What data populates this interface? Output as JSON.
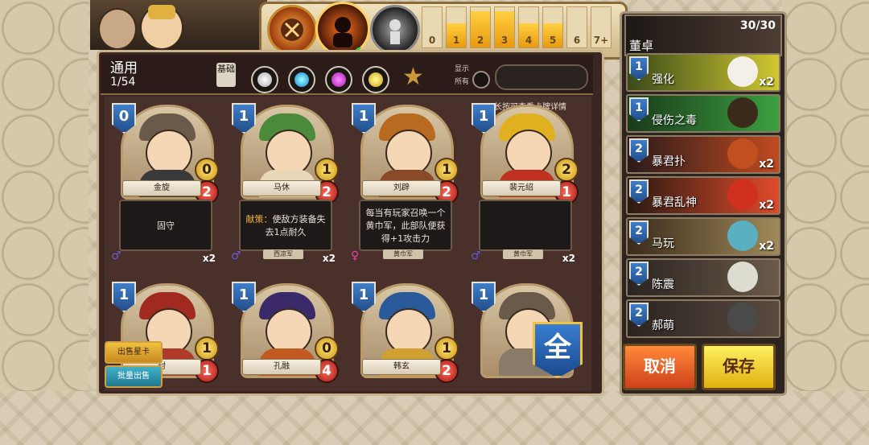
{
  "collection": {
    "title": "通用",
    "count": "1/54",
    "basic_label": "基础",
    "show_all_label_1": "显示",
    "show_all_label_2": "所有",
    "long_press_hint": "长按可查看卡牌详情"
  },
  "mana_filter": {
    "labels": [
      "0",
      "1",
      "2",
      "3",
      "4",
      "5",
      "6",
      "7+"
    ],
    "fill_ratio": [
      0.0,
      0.6,
      0.9,
      0.9,
      0.6,
      0.6,
      0.0,
      0.0
    ]
  },
  "cards_row1": [
    {
      "cost": "0",
      "name": "金旋",
      "attack": "0",
      "health": "2",
      "text": "固守",
      "keyword": "",
      "faction": "",
      "count": "x2",
      "gender": "♂",
      "gender_color": "#6b5ad0"
    },
    {
      "cost": "1",
      "name": "马休",
      "attack": "1",
      "health": "2",
      "text": "使敌方装备失去1点耐久",
      "keyword": "献策：",
      "faction": "西凉军",
      "count": "x2",
      "gender": "♂",
      "gender_color": "#6b5ad0"
    },
    {
      "cost": "1",
      "name": "刘辟",
      "attack": "1",
      "health": "2",
      "text": "每当有玩家召唤一个黄巾军，此部队便获得+1攻击力",
      "keyword": "",
      "faction": "黄巾军",
      "count": "",
      "gender": "♀",
      "gender_color": "#e04a9a"
    },
    {
      "cost": "1",
      "name": "裴元绍",
      "attack": "2",
      "health": "1",
      "text": "",
      "keyword": "",
      "faction": "黄巾军",
      "count": "x2",
      "gender": "♂",
      "gender_color": "#6b5ad0"
    }
  ],
  "cards_row2": [
    {
      "cost": "1",
      "name": "封",
      "attack": "1",
      "health": "1"
    },
    {
      "cost": "1",
      "name": "孔融",
      "attack": "0",
      "health": "4"
    },
    {
      "cost": "1",
      "name": "韩玄",
      "attack": "1",
      "health": "2"
    },
    {
      "cost": "1",
      "name": "",
      "attack": "",
      "health": ""
    }
  ],
  "all_badge": "全",
  "left_buttons": {
    "sell": "出售星卡",
    "batch": "批量出售"
  },
  "deck": {
    "hero_name": "董卓",
    "count": "30/30",
    "cards": [
      {
        "cost": "1",
        "name": "强化",
        "count": "x2"
      },
      {
        "cost": "1",
        "name": "侵伤之毒",
        "count": ""
      },
      {
        "cost": "2",
        "name": "暴君扑",
        "count": "x2"
      },
      {
        "cost": "2",
        "name": "暴君乱神",
        "count": "x2"
      },
      {
        "cost": "2",
        "name": "马玩",
        "count": "x2"
      },
      {
        "cost": "2",
        "name": "陈震",
        "count": ""
      },
      {
        "cost": "2",
        "name": "郝萌",
        "count": ""
      }
    ],
    "cancel_label": "取消",
    "save_label": "保存"
  },
  "colors": {
    "accent": "#e89a10",
    "blue_cost": "#3f7ec9",
    "cancel": "#e85a20",
    "save": "#f0c020"
  }
}
